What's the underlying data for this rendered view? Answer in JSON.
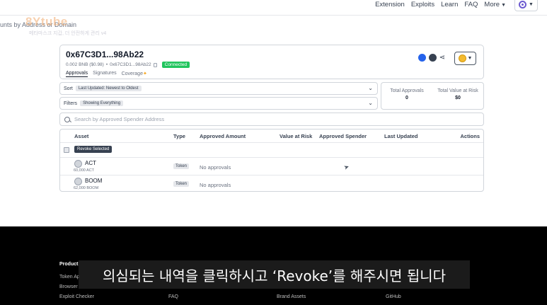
{
  "nav": {
    "links": [
      "Extension",
      "Exploits",
      "Learn",
      "FAQ",
      "More"
    ],
    "more_chevron": "chevron-down-icon"
  },
  "page_subtitle": "unts by Address or Domain",
  "watermark": {
    "logo": "8Ytube",
    "sub": "메타마스크 지갑, 더 안전하게 관리 v4"
  },
  "wallet": {
    "address": "0x67C3D1...98Ab22",
    "balance": "0.002 BNB ($0.98)",
    "short_address": "0x67C3D1...98Ab22",
    "status": "Connected",
    "tabs": [
      "Approvals",
      "Signatures",
      "Coverage"
    ]
  },
  "sort": {
    "label": "Sort",
    "value": "Last Updated: Newest to Oldest"
  },
  "filters": {
    "label": "Filters",
    "value": "Showing Everything"
  },
  "totals": {
    "approvals_label": "Total Approvals",
    "approvals_value": "0",
    "value_label": "Total Value at Risk",
    "value_value": "$0"
  },
  "search": {
    "placeholder": "Search by Approved Spender Address"
  },
  "table": {
    "headers": [
      "Asset",
      "Type",
      "Approved Amount",
      "Value at Risk",
      "Approved Spender",
      "Last Updated",
      "Actions"
    ],
    "revoke_selected": "Revoke Selected",
    "rows": [
      {
        "asset": "ACT",
        "balance": "60,000 ACT",
        "type": "Token",
        "approved": "No approvals"
      },
      {
        "asset": "BOOM",
        "balance": "62,000 BOOM",
        "type": "Token",
        "approved": "No approvals"
      }
    ]
  },
  "footer": {
    "product_heading": "Product",
    "col1": [
      "Token Ap",
      "Browser",
      "Exploit Checker"
    ],
    "col2": [
      "FAQ"
    ],
    "col3": [
      "Brand Assets"
    ],
    "col4": [
      "GitHub"
    ]
  },
  "caption": "의심되는 내역을 클릭하시고 ‘Revoke’를 해주시면 됩니다",
  "colors": {
    "connected": "#22c55e",
    "accent_purple": "#6d5bd0",
    "bnb": "#f3ba2f"
  }
}
